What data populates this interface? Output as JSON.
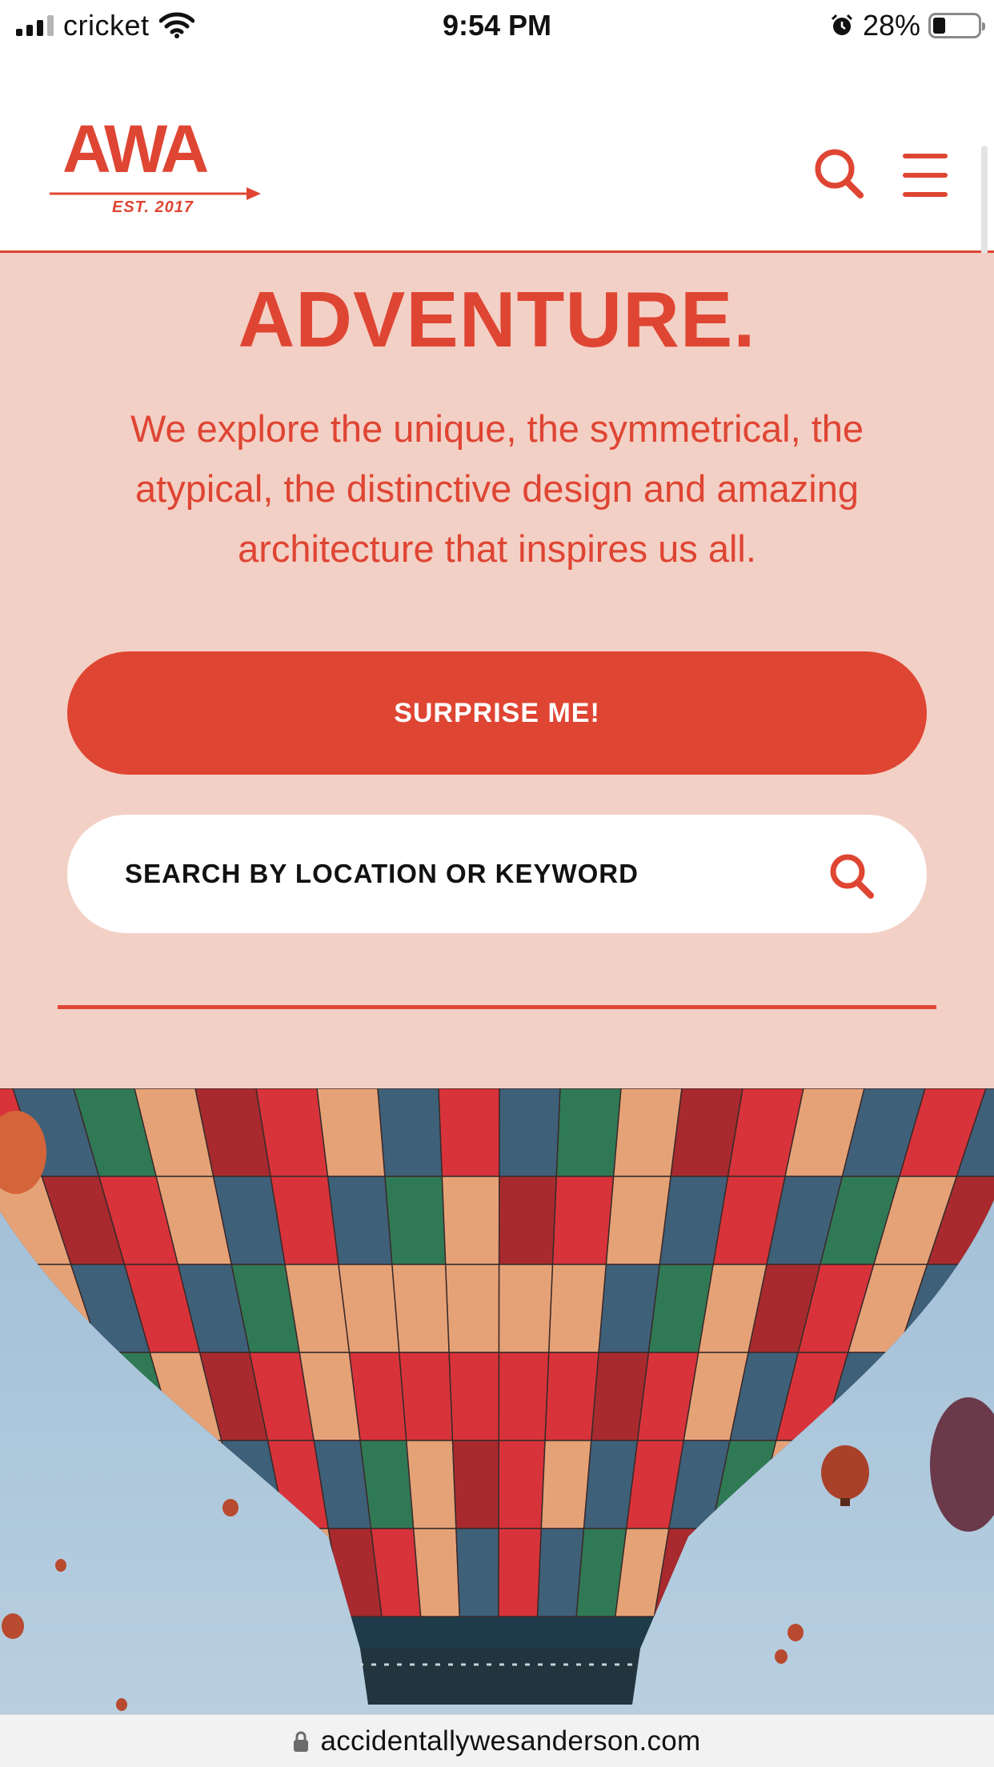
{
  "status_bar": {
    "carrier": "cricket",
    "time": "9:54 PM",
    "battery": "28%",
    "battery_level": 0.28
  },
  "header": {
    "logo_text": "AWA",
    "logo_est": "EST.  2017",
    "icons": [
      "search-icon",
      "hamburger-menu-icon"
    ]
  },
  "hero": {
    "heading": "ADVENTURE.",
    "description": "We explore the unique, the symmetrical, the atypical, the distinctive design and amazing architecture that inspires us all.",
    "surprise_button": "SURPRISE ME!",
    "search_placeholder": "SEARCH BY LOCATION OR KEYWORD"
  },
  "browser": {
    "url": "accidentallywesanderson.com"
  },
  "colors": {
    "accent": "#df4533",
    "hero_background": "#f3d0c5",
    "sky": "#a9c4d8"
  }
}
